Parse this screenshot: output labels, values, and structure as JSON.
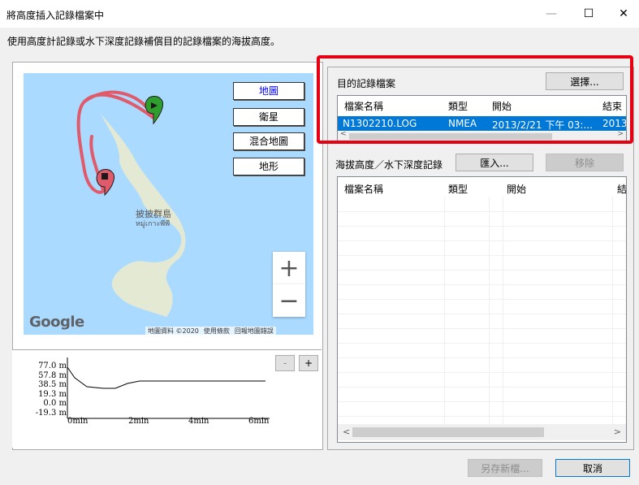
{
  "window": {
    "title": "將高度插入記錄檔案中",
    "minimize_glyph": "—",
    "maximize_glyph": "☐",
    "close_glyph": "✕"
  },
  "description": "使用高度計記錄或水下深度記錄補償目的記錄檔案的海拔高度。",
  "map": {
    "buttons": [
      "地圖",
      "衛星",
      "混合地圖",
      "地形"
    ],
    "selected": "地圖",
    "island_label_1": "披披群島",
    "island_label_2": "หมู่เกาะพีพี",
    "zoom_in": "+",
    "zoom_out": "−",
    "google_logo": "Google",
    "attribution": [
      "地圖資料 ©2020",
      "使用條款",
      "回報地圖錯誤"
    ]
  },
  "elevation_chart": {
    "minus_label": "-",
    "plus_label": "+",
    "y_ticks": [
      "77.0 m",
      "57.8 m",
      "38.5 m",
      "19.3 m",
      "0.0 m",
      "-19.3 m"
    ],
    "x_ticks": [
      "0min",
      "2min",
      "4min",
      "6min"
    ]
  },
  "target_log": {
    "label": "目的記錄檔案",
    "select_button": "選擇...",
    "columns": [
      "檔案名稱",
      "類型",
      "開始",
      "結束"
    ],
    "rows": [
      {
        "name": "N1302210.LOG",
        "type": "NMEA",
        "start": "2013/2/21 下午 03:...",
        "end": "2013"
      }
    ]
  },
  "altitude_log": {
    "label": "海拔高度／水下深度記錄",
    "import_button": "匯入...",
    "remove_button": "移除",
    "columns": [
      "檔案名稱",
      "類型",
      "",
      "開始",
      "結"
    ],
    "scroll_left": "<",
    "scroll_right": ">"
  },
  "footer": {
    "save_as": "另存新檔...",
    "cancel": "取消"
  },
  "colors": {
    "selection": "#0078d7",
    "highlight_box": "#e60012",
    "map_water": "#aadaff",
    "route": "#e05a6a"
  }
}
